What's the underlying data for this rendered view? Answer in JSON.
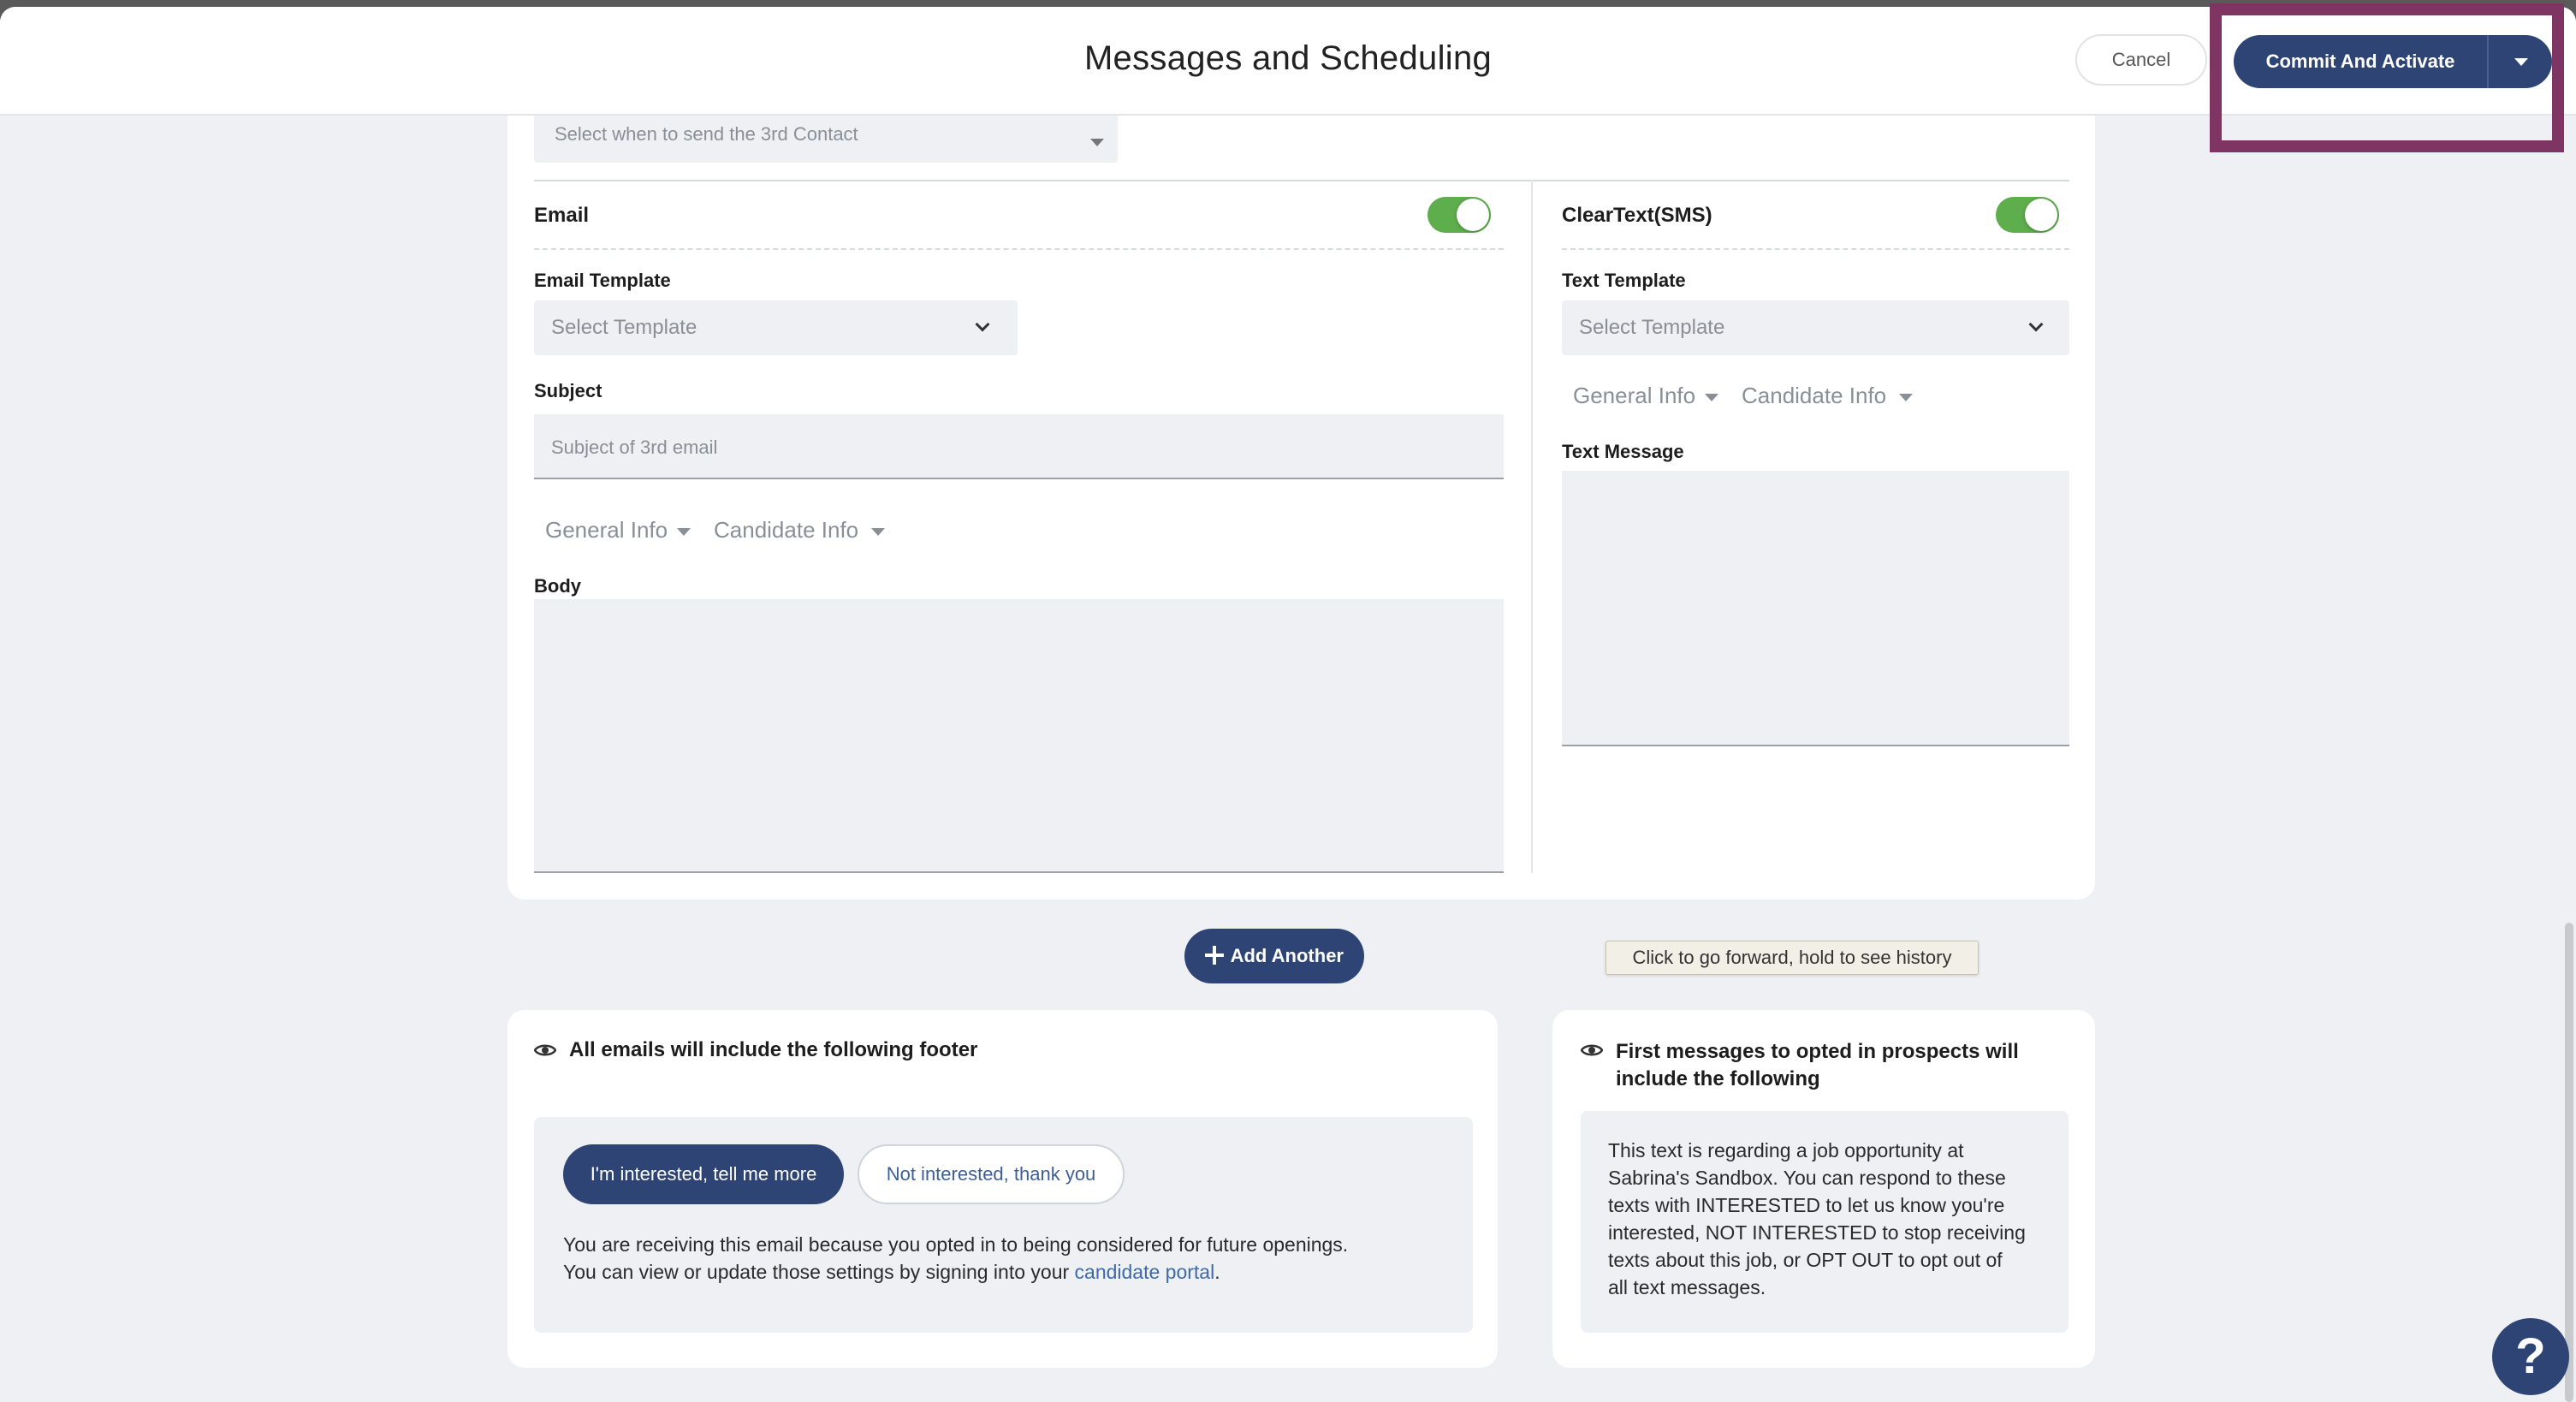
{
  "header": {
    "title": "Messages and Scheduling",
    "cancel_label": "Cancel",
    "commit_label": "Commit And Activate"
  },
  "schedule": {
    "send_when_placeholder": "Select when to send the 3rd Contact"
  },
  "email": {
    "section_title": "Email",
    "toggle_on": true,
    "template_label": "Email Template",
    "template_placeholder": "Select Template",
    "subject_label": "Subject",
    "subject_placeholder": "Subject of 3rd email",
    "general_info": "General Info",
    "candidate_info": "Candidate Info",
    "body_label": "Body"
  },
  "sms": {
    "section_title": "ClearText(SMS)",
    "toggle_on": true,
    "template_label": "Text Template",
    "template_placeholder": "Select Template",
    "general_info": "General Info",
    "candidate_info": "Candidate Info",
    "message_label": "Text Message"
  },
  "add_another_label": "Add Another",
  "tooltip": "Click to go forward, hold to see history",
  "email_footer": {
    "heading": "All emails will include the following footer",
    "interested_label": "I'm interested, tell me more",
    "not_interested_label": "Not interested, thank you",
    "line1": "You are receiving this email because you opted in to being considered for future openings.",
    "line2_prefix": "You can view or update those settings by signing into your ",
    "link_text": "candidate portal",
    "line2_suffix": "."
  },
  "sms_footer": {
    "heading_line1": "First messages to opted in prospects will",
    "heading_line2": "include the following",
    "text_lines": [
      "This text is regarding a job opportunity at",
      "Sabrina's Sandbox. You can respond to these",
      "texts with INTERESTED to let us know you're",
      "interested, NOT INTERESTED to stop receiving",
      "texts about this job, or OPT OUT to opt out of",
      "all text messages."
    ]
  },
  "help_label": "?",
  "colors": {
    "primary": "#2d4474",
    "toggle_on": "#5fae4e",
    "highlight": "#7f3563",
    "link": "#3d6aa8"
  }
}
